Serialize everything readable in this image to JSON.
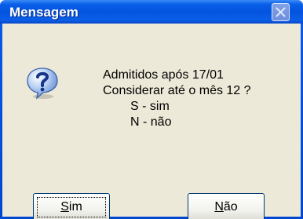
{
  "window": {
    "title": "Mensagem"
  },
  "icon": "question-icon",
  "message": {
    "line1": "Admitidos após 17/01",
    "line2": "Considerar até o mês 12 ?",
    "option_yes": "S - sim",
    "option_no": "N - não"
  },
  "buttons": {
    "yes": {
      "access_key": "S",
      "rest": "im"
    },
    "no": {
      "access_key": "N",
      "rest": "ão"
    }
  },
  "colors": {
    "titlebar": "#0453df",
    "client_background": "#ece9d8",
    "button_border": "#003c74"
  }
}
